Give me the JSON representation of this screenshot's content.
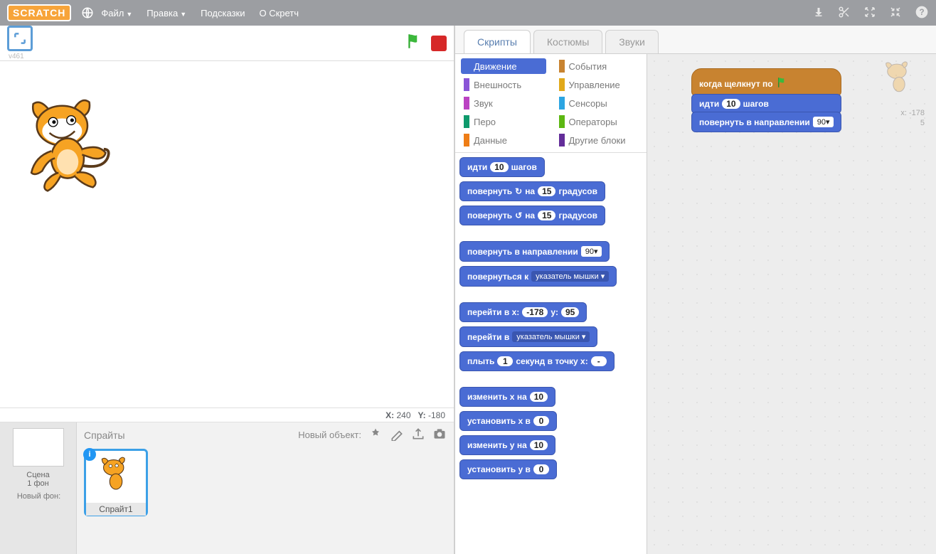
{
  "menu": {
    "file": "Файл",
    "edit": "Правка",
    "tips": "Подсказки",
    "about": "О Скретч"
  },
  "stage": {
    "version": "v461",
    "coords_label_x": "X:",
    "coords_label_y": "Y:",
    "coords_x": "240",
    "coords_y": "-180"
  },
  "tabs": {
    "scripts": "Скрипты",
    "costumes": "Костюмы",
    "sounds": "Звуки"
  },
  "categories": {
    "motion": "Движение",
    "looks": "Внешность",
    "sound": "Звук",
    "pen": "Перо",
    "data": "Данные",
    "events": "События",
    "control": "Управление",
    "sensing": "Сенсоры",
    "operators": "Операторы",
    "more": "Другие блоки"
  },
  "colors": {
    "motion": "#4a6cd4",
    "looks": "#8a55d7",
    "sound": "#bb42c3",
    "pen": "#0e9a6c",
    "data": "#ee7d16",
    "events": "#c88330",
    "control": "#e1a91a",
    "sensing": "#2ca5e2",
    "operators": "#5cb712",
    "more": "#632d99"
  },
  "palette": {
    "move_pre": "идти",
    "move_val": "10",
    "move_post": "шагов",
    "turn_cw_pre": "повернуть",
    "turn_cw_mid": "на",
    "turn_cw_val": "15",
    "turn_cw_post": "градусов",
    "turn_ccw_pre": "повернуть",
    "turn_ccw_mid": "на",
    "turn_ccw_val": "15",
    "turn_ccw_post": "градусов",
    "point_dir_pre": "повернуть в направлении",
    "point_dir_val": "90",
    "point_towards_pre": "повернуться к",
    "point_towards_val": "указатель мышки",
    "goto_xy_pre": "перейти в x:",
    "goto_xy_x": "-178",
    "goto_xy_mid": "y:",
    "goto_xy_y": "95",
    "goto_pre": "перейти в",
    "goto_val": "указатель мышки",
    "glide_pre": "плыть",
    "glide_secs": "1",
    "glide_mid": "секунд в точку x:",
    "glide_x": "-",
    "change_x_pre": "изменить x на",
    "change_x_val": "10",
    "set_x_pre": "установить x в",
    "set_x_val": "0",
    "change_y_pre": "изменить y на",
    "change_y_val": "10",
    "set_y_pre": "установить y в",
    "set_y_val": "0"
  },
  "script": {
    "when_flag": "когда щелкнут по",
    "move_pre": "идти",
    "move_val": "10",
    "move_post": "шагов",
    "point_dir_pre": "повернуть в направлении",
    "point_dir_val": "90",
    "sprite_x_label": "x:",
    "sprite_x": "-178",
    "sprite_y": "5"
  },
  "sprites": {
    "header": "Спрайты",
    "new_object": "Новый объект:",
    "scene_label": "Сцена",
    "scene_sub": "1 фон",
    "new_backdrop": "Новый фон:",
    "sprite1_name": "Спрайт1"
  }
}
